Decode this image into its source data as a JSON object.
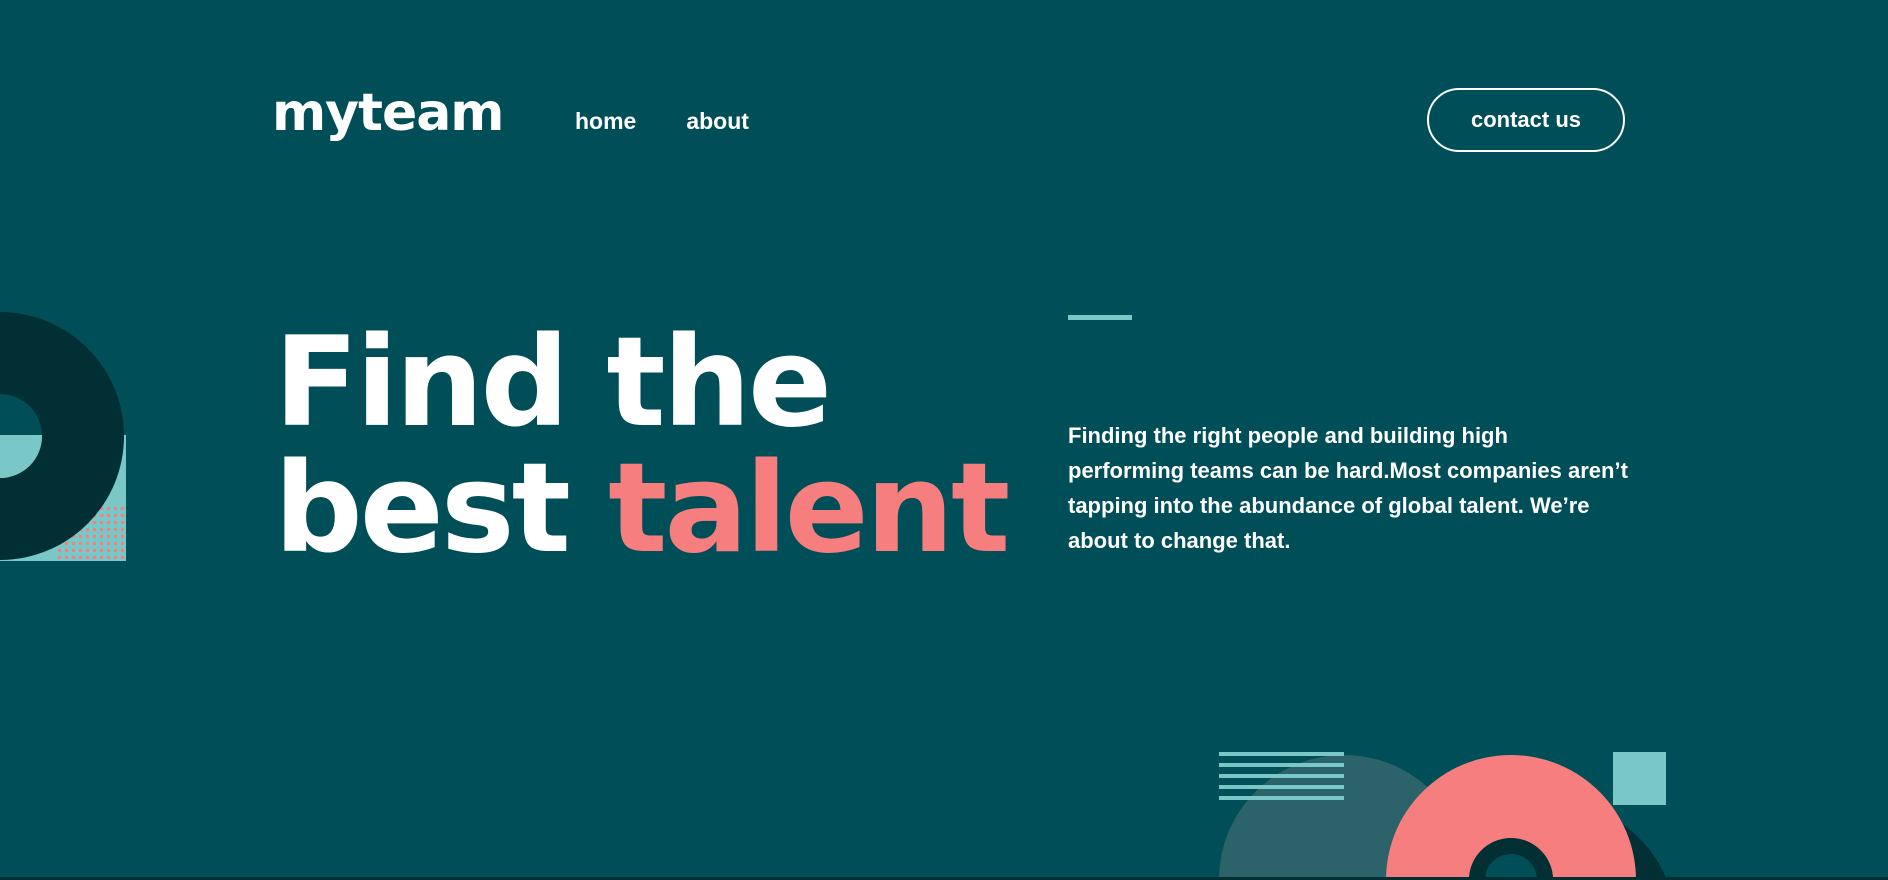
{
  "header": {
    "logo": "myteam",
    "nav": [
      {
        "label": "home"
      },
      {
        "label": "about"
      }
    ],
    "contact_label": "contact us"
  },
  "hero": {
    "title_line1": "Find the",
    "title_line2_plain": "best ",
    "title_line2_accent": "talent",
    "description": "Finding the right people and building high performing teams can be hard.Most companies aren’t tapping into the abundance of global talent. We’re about to change that."
  },
  "colors": {
    "background": "#004f58",
    "accent_coral": "#f67e7e",
    "accent_teal": "#79c8c7",
    "dark_teal": "#012f34",
    "muted_teal": "#2c6269",
    "text": "#ffffff"
  }
}
